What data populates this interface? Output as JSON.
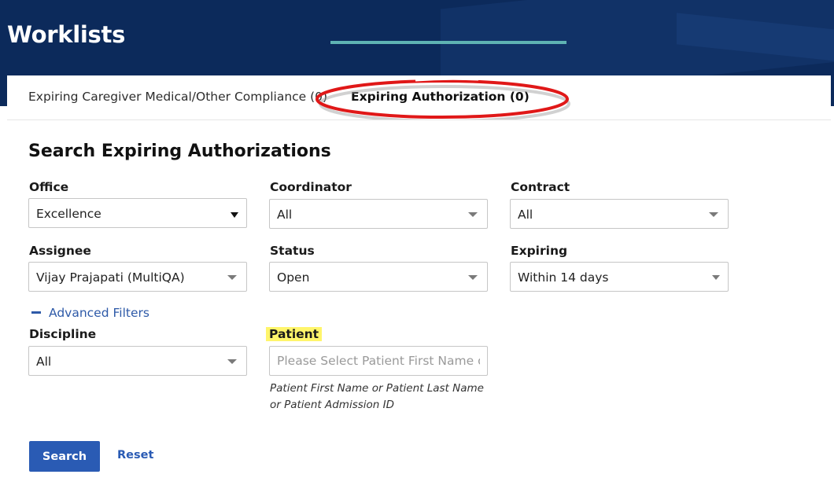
{
  "header": {
    "title": "Worklists"
  },
  "tabs": [
    {
      "label": "Expiring Caregiver Medical/Other Compliance (0)"
    },
    {
      "label": "Expiring Authorization (0)"
    }
  ],
  "search": {
    "title": "Search Expiring Authorizations",
    "office": {
      "label": "Office",
      "value": "Excellence"
    },
    "coordinator": {
      "label": "Coordinator",
      "value": "All"
    },
    "contract": {
      "label": "Contract",
      "value": "All"
    },
    "assignee": {
      "label": "Assignee",
      "value": "Vijay Prajapati (MultiQA)"
    },
    "status": {
      "label": "Status",
      "value": "Open"
    },
    "expiring": {
      "label": "Expiring",
      "value": "Within 14 days"
    },
    "advanced_filters": "Advanced Filters",
    "discipline": {
      "label": "Discipline",
      "value": "All"
    },
    "patient": {
      "label": "Patient",
      "placeholder": "Please Select Patient First Name or Last Name",
      "value": "",
      "help": "Patient First Name or Patient Last Name or Patient Admission ID"
    },
    "search_button": "Search",
    "reset_button": "Reset"
  },
  "colors": {
    "header_bg": "#0c2a5b",
    "primary": "#2a5bb4",
    "tab_underline": "#5fb3b3",
    "annotation": "#e01818",
    "highlight": "#fff56b"
  }
}
